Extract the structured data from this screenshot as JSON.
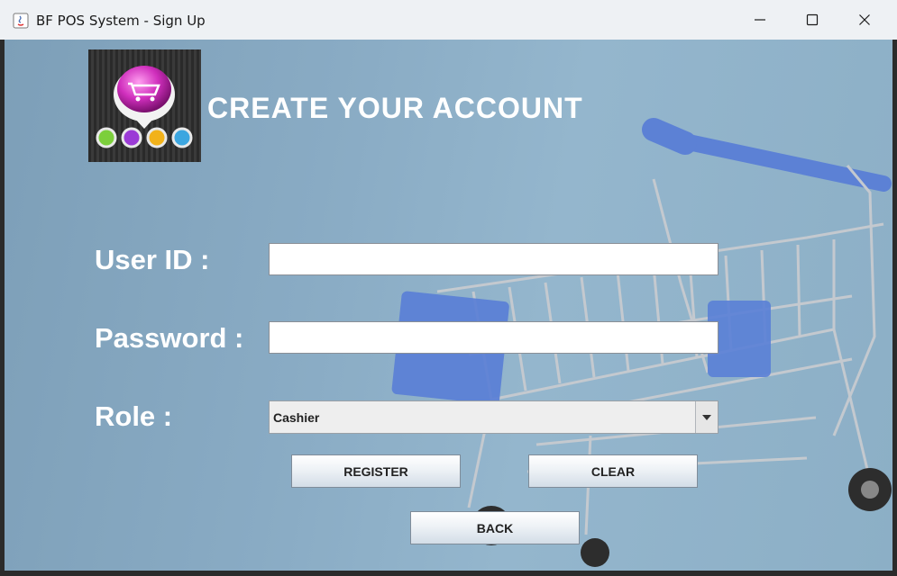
{
  "window": {
    "title": "BF POS System - Sign Up",
    "controls": {
      "minimize_icon": "minimize-icon",
      "maximize_icon": "maximize-icon",
      "close_icon": "close-icon"
    }
  },
  "form": {
    "heading": "CREATE YOUR ACCOUNT",
    "user_id_label": "User ID :",
    "user_id_value": "",
    "password_label": "Password :",
    "password_value": "",
    "role_label": "Role :",
    "role_selected": "Cashier",
    "buttons": {
      "register": "REGISTER",
      "clear": "CLEAR",
      "back": "BACK"
    }
  },
  "colors": {
    "background": "#89abc4",
    "label_text": "#ffffff",
    "cart_blue": "#5a7fd6"
  }
}
